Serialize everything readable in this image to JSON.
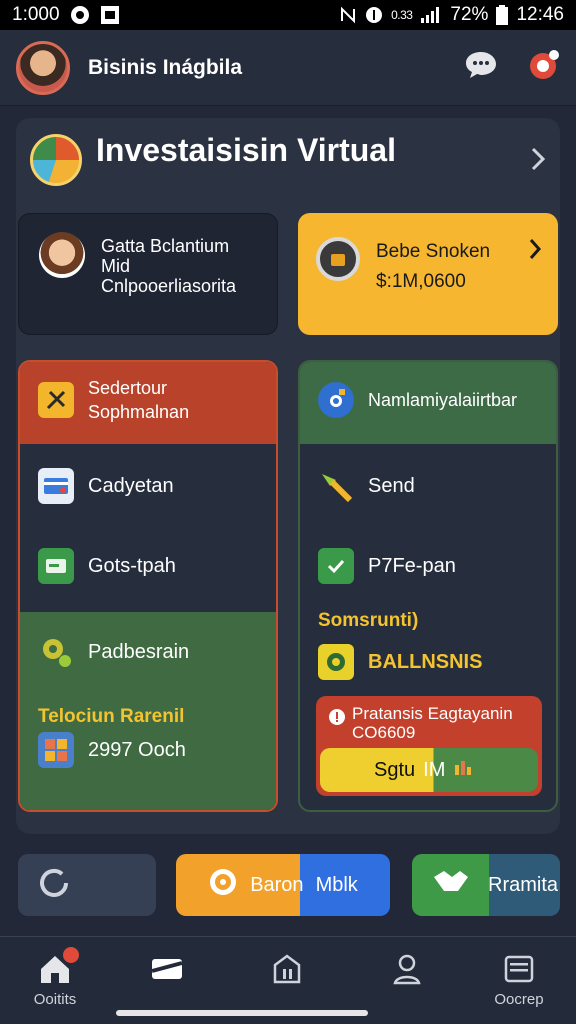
{
  "status_bar": {
    "time": "1:000",
    "battery": "72%",
    "clock": "12:46",
    "net_small": "0.33"
  },
  "header": {
    "title": "Bisinis Inágbila"
  },
  "section": {
    "title": "Investaisisin Virtual"
  },
  "profile_card": {
    "line1": "Gatta Bclantium",
    "line2": "Mid",
    "line3": "Cnlpooerliasorita"
  },
  "balance_card": {
    "label": "Bebe Snoken",
    "amount": "$:1M,0600"
  },
  "left_col": {
    "header": [
      "Sedertour",
      "Sophmalnan"
    ],
    "items": [
      {
        "label": "Cadyetan"
      },
      {
        "label": "Gots-tpah"
      },
      {
        "label": "Padbesrain"
      }
    ],
    "stat_label": "Telociun Rarenil",
    "stat_value": "2997 Ooch"
  },
  "right_col": {
    "header": "Namlamiyalaiirtbar",
    "items": [
      {
        "label": "Send"
      },
      {
        "label": "P7Fe-pan"
      }
    ],
    "label": "Somsrunti)",
    "status": "BALLNSNIS",
    "sub_card": {
      "title": "Pratansis Eagtayanin",
      "code": "CO6609",
      "cta_left": "Sgtu",
      "cta_right": "IM"
    }
  },
  "actions": {
    "a2_left": "Baron",
    "a2_right": "Mblk",
    "a3": "Rramita"
  },
  "nav": {
    "item1": "Ooitits",
    "item5": "Oocrep"
  },
  "colors": {
    "bg": "#222838",
    "accent_orange": "#f6b630",
    "accent_red": "#b8432a",
    "accent_green": "#3f6a42",
    "accent_blue": "#2f6fe0"
  }
}
